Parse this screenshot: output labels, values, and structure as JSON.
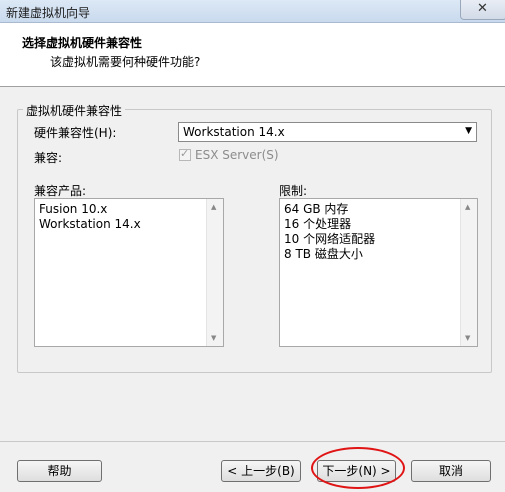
{
  "window": {
    "title": "新建虚拟机向导",
    "close_label": "✕"
  },
  "header": {
    "title": "选择虚拟机硬件兼容性",
    "subtitle": "该虚拟机需要何种硬件功能?"
  },
  "group": {
    "legend": "虚拟机硬件兼容性",
    "compat_label": "硬件兼容性(H):",
    "compat_value": "Workstation 14.x",
    "compatible_label": "兼容:",
    "esx_checked": true,
    "esx_label": "ESX Server(S)",
    "products_label": "兼容产品:",
    "products": [
      "Fusion 10.x",
      "Workstation 14.x"
    ],
    "limits_label": "限制:",
    "limits": [
      "64 GB 内存",
      "16 个处理器",
      "10 个网络适配器",
      "8 TB 磁盘大小"
    ]
  },
  "buttons": {
    "help": "帮助",
    "back": "< 上一步(B)",
    "next": "下一步(N) >",
    "cancel": "取消"
  }
}
